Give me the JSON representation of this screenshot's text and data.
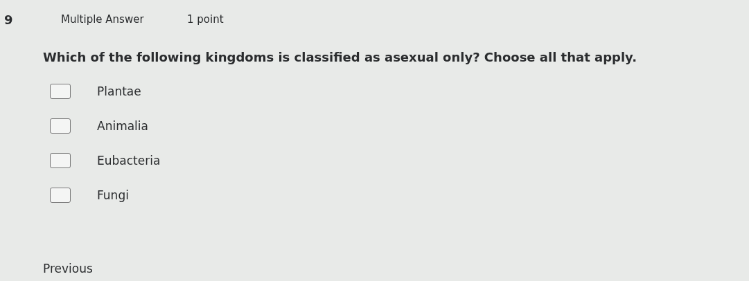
{
  "question": {
    "number": "9",
    "type": "Multiple Answer",
    "points": "1 point",
    "text": "Which of the following kingdoms is classified as asexual only? Choose all that apply.",
    "options": [
      {
        "label": "Plantae",
        "checked": false
      },
      {
        "label": "Animalia",
        "checked": false
      },
      {
        "label": "Eubacteria",
        "checked": false
      },
      {
        "label": "Fungi",
        "checked": false
      }
    ]
  },
  "navigation": {
    "previous": "Previous"
  }
}
